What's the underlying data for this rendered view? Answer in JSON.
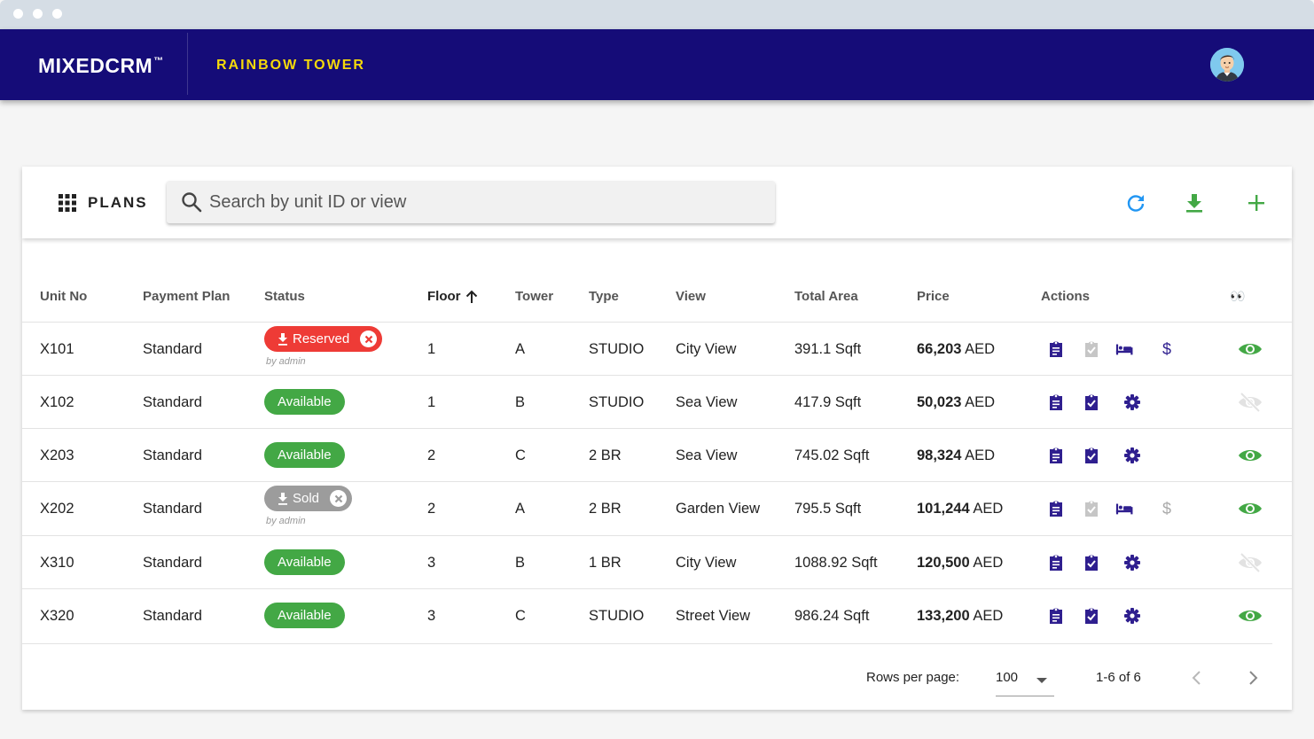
{
  "app": {
    "brand": "MIXEDCRM",
    "trademark": "™",
    "project": "RAINBOW TOWER"
  },
  "toolbar": {
    "title": "PLANS",
    "search_placeholder": "Search by unit ID or view"
  },
  "table": {
    "headers": {
      "unit": "Unit No",
      "plan": "Payment Plan",
      "status": "Status",
      "floor": "Floor",
      "tower": "Tower",
      "type": "Type",
      "view": "View",
      "area": "Total Area",
      "price": "Price",
      "actions": "Actions",
      "visibility": "👀"
    },
    "rows": [
      {
        "unit": "X101",
        "plan": "Standard",
        "status": "Reserved",
        "status_by": "by admin",
        "floor": "1",
        "tower": "A",
        "type": "STUDIO",
        "view": "City View",
        "area": "391.1 Sqft",
        "price": "66,203",
        "currency": "AED"
      },
      {
        "unit": "X102",
        "plan": "Standard",
        "status": "Available",
        "status_by": "",
        "floor": "1",
        "tower": "B",
        "type": "STUDIO",
        "view": "Sea View",
        "area": "417.9 Sqft",
        "price": "50,023",
        "currency": "AED"
      },
      {
        "unit": "X203",
        "plan": "Standard",
        "status": "Available",
        "status_by": "",
        "floor": "2",
        "tower": "C",
        "type": "2 BR",
        "view": "Sea View",
        "area": "745.02 Sqft",
        "price": "98,324",
        "currency": "AED"
      },
      {
        "unit": "X202",
        "plan": "Standard",
        "status": "Sold",
        "status_by": "by admin",
        "floor": "2",
        "tower": "A",
        "type": "2 BR",
        "view": "Garden View",
        "area": "795.5 Sqft",
        "price": "101,244",
        "currency": "AED"
      },
      {
        "unit": "X310",
        "plan": "Standard",
        "status": "Available",
        "status_by": "",
        "floor": "3",
        "tower": "B",
        "type": "1 BR",
        "view": "City View",
        "area": "1088.92 Sqft",
        "price": "120,500",
        "currency": "AED"
      },
      {
        "unit": "X320",
        "plan": "Standard",
        "status": "Available",
        "status_by": "",
        "floor": "3",
        "tower": "C",
        "type": "STUDIO",
        "view": "Street View",
        "area": "986.24 Sqft",
        "price": "133,200",
        "currency": "AED"
      }
    ]
  },
  "pagination": {
    "rows_label": "Rows per page:",
    "rows_value": "100",
    "range": "1-6 of 6"
  },
  "colors": {
    "appbar": "#150c78",
    "project": "#f5d90a",
    "accent_blue": "#2196f3",
    "accent_green": "#43a845",
    "reserved": "#ee3b36",
    "sold": "#9c9c9c",
    "action_icon": "#2f1f8f"
  },
  "icons": {
    "toolbar": [
      "apps-grid-icon",
      "search-icon",
      "refresh-icon",
      "download-icon",
      "add-icon"
    ],
    "row_actions": [
      "clipboard-icon",
      "assignment-check-icon",
      "bed-icon",
      "dollar-icon",
      "settings-icon"
    ],
    "visibility": [
      "eye-icon",
      "eye-off-icon"
    ],
    "pager": [
      "chevron-left-icon",
      "chevron-right-icon"
    ]
  }
}
